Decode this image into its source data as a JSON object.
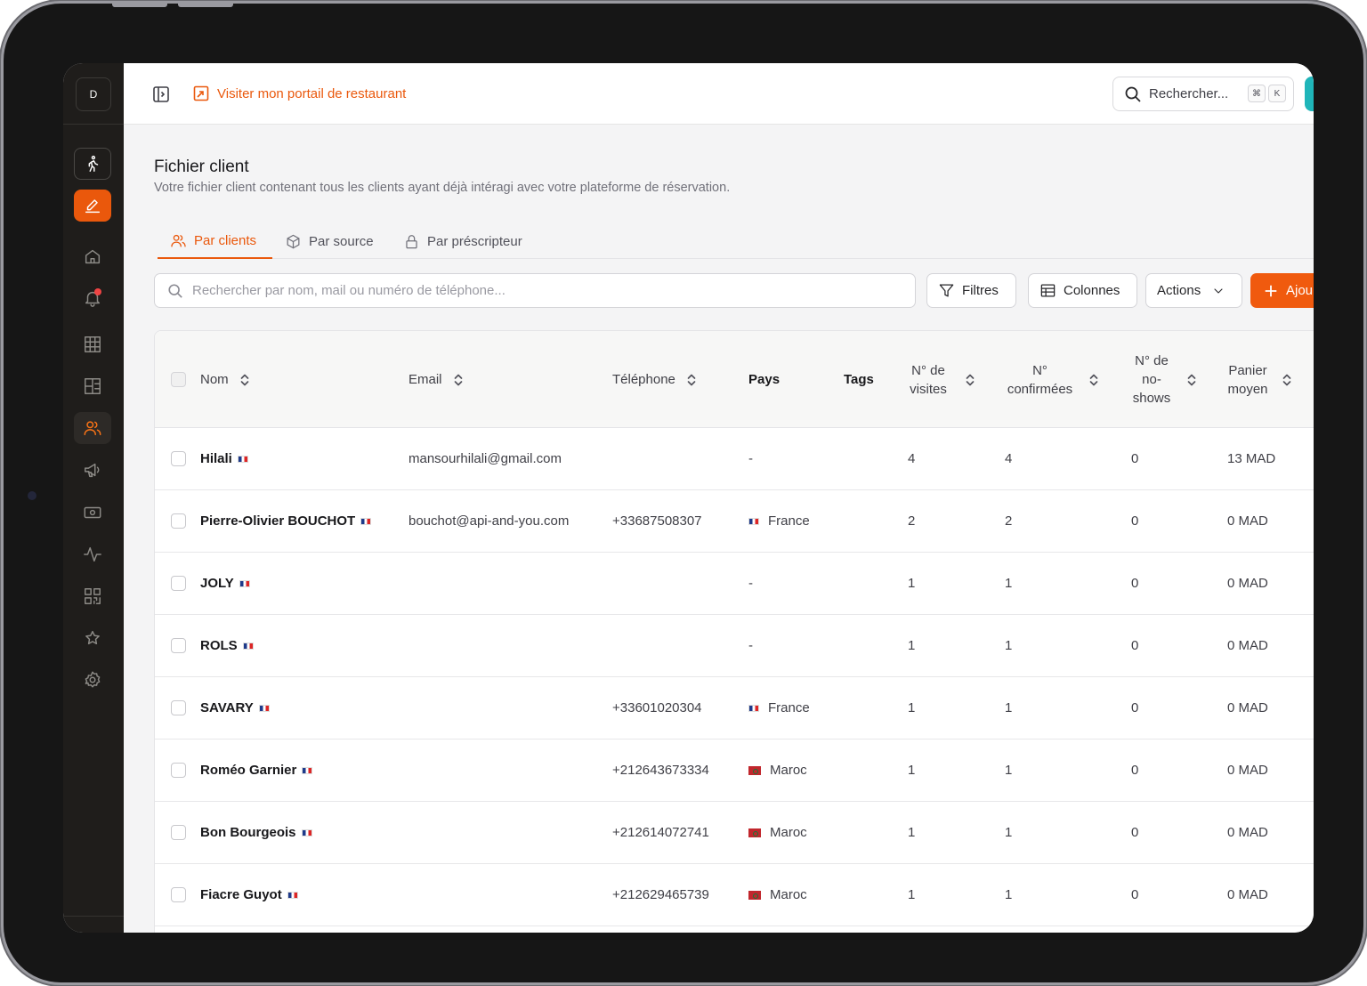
{
  "app": {
    "logo_letter": "D",
    "portal_link": "Visiter mon portail de restaurant",
    "global_search": {
      "label": "Rechercher...",
      "kbd": [
        "⌘",
        "K"
      ]
    }
  },
  "sidebar": {
    "items": [
      {
        "name": "walk-in-icon"
      },
      {
        "name": "edit-icon"
      },
      {
        "name": "home-icon"
      },
      {
        "name": "bell-icon"
      },
      {
        "name": "grid-icon"
      },
      {
        "name": "floor-plan-icon"
      },
      {
        "name": "users-icon"
      },
      {
        "name": "megaphone-icon"
      },
      {
        "name": "cash-icon"
      },
      {
        "name": "activity-icon"
      },
      {
        "name": "qr-code-icon"
      },
      {
        "name": "star-icon"
      },
      {
        "name": "settings-icon"
      }
    ]
  },
  "page": {
    "title": "Fichier client",
    "subtitle": "Votre fichier client contenant tous les clients ayant déjà intéragi avec votre plateforme de réservation."
  },
  "tabs": [
    {
      "label": "Par clients",
      "icon": "users-icon",
      "active": true
    },
    {
      "label": "Par source",
      "icon": "box-icon",
      "active": false
    },
    {
      "label": "Par préscripteur",
      "icon": "lock-icon",
      "active": false
    }
  ],
  "toolbar": {
    "search_placeholder": "Rechercher par nom, mail ou numéro de téléphone...",
    "filters_label": "Filtres",
    "columns_label": "Colonnes",
    "actions_label": "Actions",
    "add_label": "Ajou"
  },
  "table": {
    "headers": {
      "name": "Nom",
      "email": "Email",
      "phone": "Téléphone",
      "country": "Pays",
      "tags": "Tags",
      "visits": "N° de visites",
      "confirmed": "N° confirmées",
      "noshows": "N° de no-shows",
      "basket": "Panier moyen"
    },
    "rows": [
      {
        "name": "Hilali",
        "email": "mansourhilali@gmail.com",
        "phone": "",
        "country": "-",
        "visits": "4",
        "confirmed": "4",
        "noshows": "0",
        "basket": "13 MAD"
      },
      {
        "name": "Pierre-Olivier BOUCHOT",
        "email": "bouchot@api-and-you.com",
        "phone": "+33687508307",
        "country": "France",
        "visits": "2",
        "confirmed": "2",
        "noshows": "0",
        "basket": "0 MAD"
      },
      {
        "name": "JOLY",
        "email": "",
        "phone": "",
        "country": "-",
        "visits": "1",
        "confirmed": "1",
        "noshows": "0",
        "basket": "0 MAD"
      },
      {
        "name": "ROLS",
        "email": "",
        "phone": "",
        "country": "-",
        "visits": "1",
        "confirmed": "1",
        "noshows": "0",
        "basket": "0 MAD"
      },
      {
        "name": "SAVARY",
        "email": "",
        "phone": "+33601020304",
        "country": "France",
        "visits": "1",
        "confirmed": "1",
        "noshows": "0",
        "basket": "0 MAD"
      },
      {
        "name": "Roméo Garnier",
        "email": "",
        "phone": "+212643673334",
        "country": "Maroc",
        "visits": "1",
        "confirmed": "1",
        "noshows": "0",
        "basket": "0 MAD"
      },
      {
        "name": "Bon Bourgeois",
        "email": "",
        "phone": "+212614072741",
        "country": "Maroc",
        "visits": "1",
        "confirmed": "1",
        "noshows": "0",
        "basket": "0 MAD"
      },
      {
        "name": "Fiacre Guyot",
        "email": "",
        "phone": "+212629465739",
        "country": "Maroc",
        "visits": "1",
        "confirmed": "1",
        "noshows": "0",
        "basket": "0 MAD"
      }
    ]
  },
  "colors": {
    "accent": "#ea580c",
    "sidebar_bg": "#1f1d1b",
    "teal": "#1fb5b9"
  }
}
